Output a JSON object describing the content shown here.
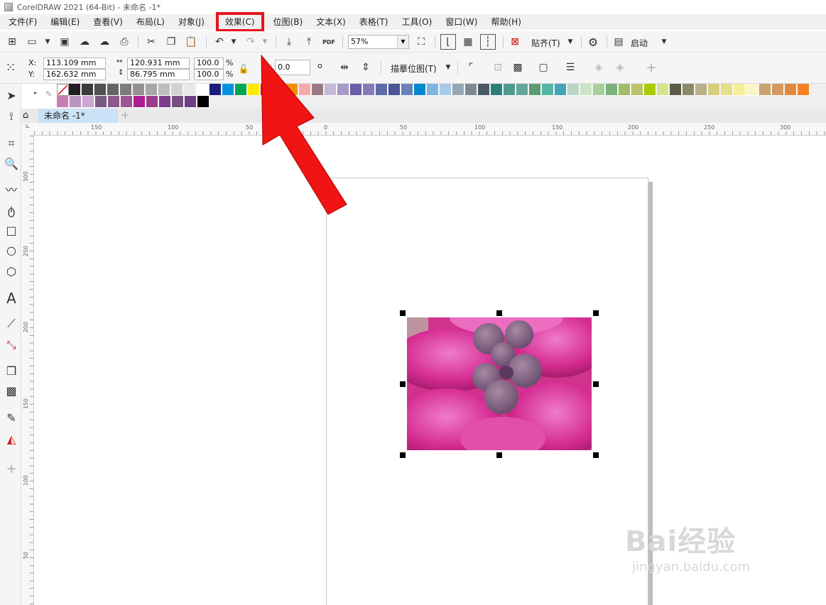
{
  "window": {
    "title": "CorelDRAW 2021 (64-Bit) - 未命名 -1*"
  },
  "menu": [
    "文件(F)",
    "编辑(E)",
    "查看(V)",
    "布局(L)",
    "对象(J)",
    "效果(C)",
    "位图(B)",
    "文本(X)",
    "表格(T)",
    "工具(O)",
    "窗口(W)",
    "帮助(H)"
  ],
  "toolbar": {
    "zoom": "57%",
    "snap_label": "贴齐(T)",
    "launch_label": "启动",
    "pdf_label": "PDF"
  },
  "properties": {
    "x_label": "X:",
    "y_label": "Y:",
    "x_value": "113.109 mm",
    "y_value": "162.632 mm",
    "width_value": "120.931 mm",
    "height_value": "86.795 mm",
    "scale_w": "100.0",
    "scale_h": "100.0",
    "percent": "%",
    "rotation": "0.0",
    "trace_bitmap": "描摹位图(T)"
  },
  "document": {
    "tab_label": "未命名 -1*"
  },
  "ruler": {
    "h_labels": [
      "150",
      "100",
      "50",
      "0",
      "50",
      "100",
      "150",
      "200",
      "250",
      "300"
    ],
    "v_labels": [
      "300",
      "250",
      "200",
      "150",
      "100",
      "50"
    ]
  },
  "palette": {
    "row1": [
      "#231f20",
      "#3d3a3b",
      "#525050",
      "#666464",
      "#7d7b7b",
      "#939192",
      "#a8a6a7",
      "#bebcbd",
      "#d4d2d3",
      "#e9e8e8",
      "#ffffff",
      "#1a1d7c",
      "#0093dd",
      "#00a651",
      "#ffed00",
      "#e30613",
      "#e6007e",
      "#f29100",
      "#f7a9a8",
      "#9a7b85",
      "#c7b8d6",
      "#a79bc9",
      "#6c5da8",
      "#8579b6",
      "#5d6aa7",
      "#4c5593",
      "#6a82b8",
      "#0089cf",
      "#7fb5e0",
      "#a7cae8",
      "#96a8b6",
      "#7a8b95",
      "#4a5b63",
      "#2b7f7a",
      "#4f9a8f",
      "#66a69a",
      "#5a9c6e",
      "#53b5a5",
      "#47a3b8",
      "#b9d5c5",
      "#cde3c6",
      "#a8d09a",
      "#7ab27a",
      "#a3bd6c",
      "#bcc36a",
      "#a9c900",
      "#d6e28c",
      "#5c5c46",
      "#8c8968",
      "#b7b089",
      "#d6ce7c",
      "#e5e085",
      "#f6ef98",
      "#fbf6c5",
      "#c9a36f",
      "#d29a5e",
      "#e08a3f",
      "#f58220"
    ],
    "row2": [
      "#c67fb3",
      "#b994c1",
      "#cfa5d1",
      "#785c84",
      "#8c5a8a",
      "#9d5596",
      "#ad1f8e",
      "#9b3d8f",
      "#7d3c8c",
      "#774f7f",
      "#6e3f85",
      "#000000"
    ]
  },
  "colors": {
    "highlight": "#e8141b",
    "arrow": "#f01414",
    "selection": "#000000"
  },
  "watermark": {
    "brand": "Bai经验",
    "url": "jingyan.baidu.com"
  }
}
